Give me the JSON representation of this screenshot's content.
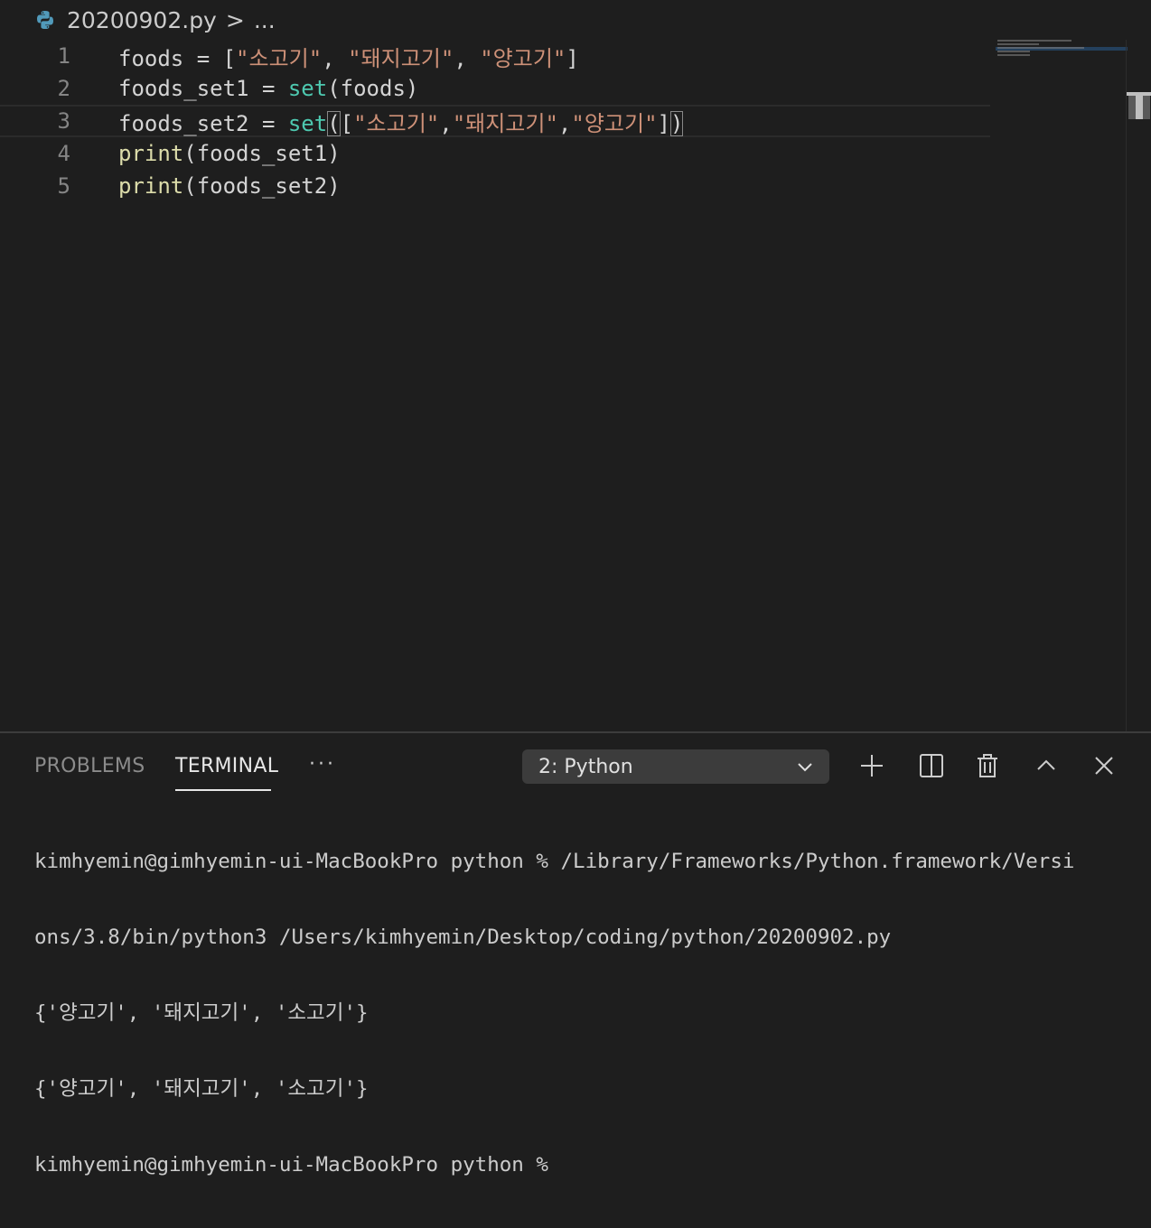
{
  "breadcrumb": {
    "file_name": "20200902.py",
    "separator": ">",
    "ellipsis": "..."
  },
  "editor": {
    "lines": [
      {
        "num": "1",
        "tokens": [
          {
            "t": "plain",
            "v": "foods = ["
          },
          {
            "t": "str",
            "v": "\"소고기\""
          },
          {
            "t": "plain",
            "v": ", "
          },
          {
            "t": "str",
            "v": "\"돼지고기\""
          },
          {
            "t": "plain",
            "v": ", "
          },
          {
            "t": "str",
            "v": "\"양고기\""
          },
          {
            "t": "plain",
            "v": "]"
          }
        ]
      },
      {
        "num": "2",
        "tokens": [
          {
            "t": "plain",
            "v": "foods_set1 = "
          },
          {
            "t": "fn",
            "v": "set"
          },
          {
            "t": "plain",
            "v": "(foods)"
          }
        ]
      },
      {
        "num": "3",
        "tokens": [
          {
            "t": "plain",
            "v": "foods_set2 = "
          },
          {
            "t": "fn",
            "v": "set"
          },
          {
            "t": "bracket",
            "v": "("
          },
          {
            "t": "plain",
            "v": "["
          },
          {
            "t": "str",
            "v": "\"소고기\""
          },
          {
            "t": "plain",
            "v": ","
          },
          {
            "t": "str",
            "v": "\"돼지고기\""
          },
          {
            "t": "plain",
            "v": ","
          },
          {
            "t": "str",
            "v": "\"양고기\""
          },
          {
            "t": "plain",
            "v": "]"
          },
          {
            "t": "bracket",
            "v": ")"
          }
        ]
      },
      {
        "num": "4",
        "tokens": [
          {
            "t": "pr",
            "v": "print"
          },
          {
            "t": "plain",
            "v": "(foods_set1)"
          }
        ]
      },
      {
        "num": "5",
        "tokens": [
          {
            "t": "pr",
            "v": "print"
          },
          {
            "t": "plain",
            "v": "(foods_set2)"
          }
        ]
      }
    ],
    "current_line": 3
  },
  "panel": {
    "tabs": {
      "problems": "PROBLEMS",
      "terminal": "TERMINAL",
      "more": "···"
    },
    "terminal_select": "2: Python",
    "terminal_lines": [
      "kimhyemin@gimhyemin-ui-MacBookPro python % /Library/Frameworks/Python.framework/Versi",
      "ons/3.8/bin/python3 /Users/kimhyemin/Desktop/coding/python/20200902.py",
      "{'양고기', '돼지고기', '소고기'}",
      "{'양고기', '돼지고기', '소고기'}",
      "kimhyemin@gimhyemin-ui-MacBookPro python % "
    ]
  },
  "colors": {
    "background": "#1e1e1e",
    "string": "#ce9178",
    "builtin_fn": "#4ec9b0",
    "print_fn": "#dcdcaa",
    "python_icon": "#519aba"
  },
  "icons": {
    "file": "python-icon",
    "buttons": [
      "plus-icon",
      "split-icon",
      "trash-icon",
      "chevron-up-icon",
      "close-icon"
    ],
    "select": "chevron-down-icon"
  }
}
